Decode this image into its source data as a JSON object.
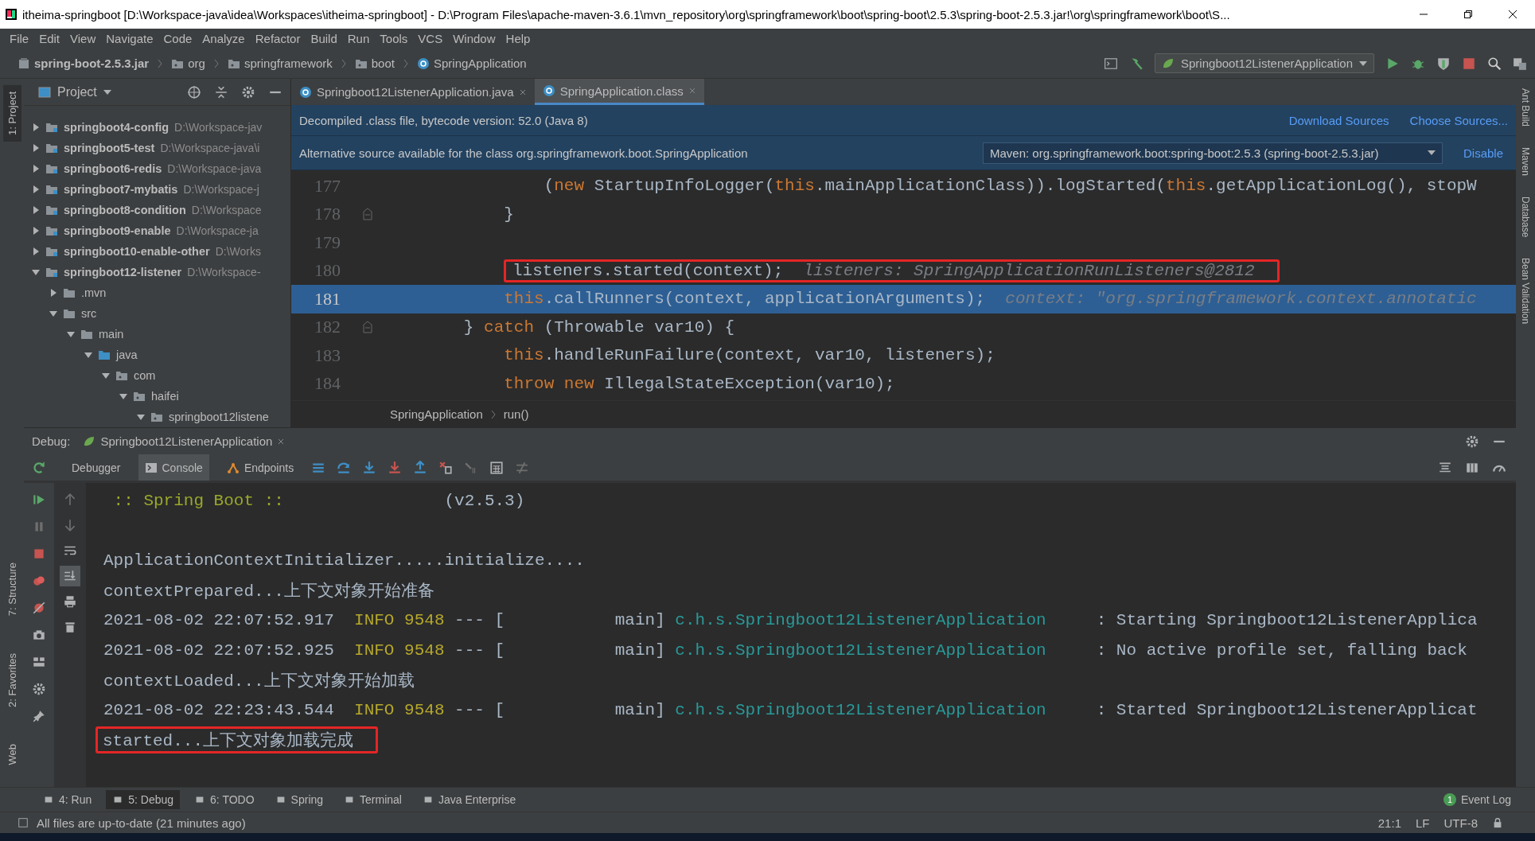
{
  "window": {
    "title": "itheima-springboot [D:\\Workspace-java\\idea\\Workspaces\\itheima-springboot] - D:\\Program Files\\apache-maven-3.6.1\\mvn_repository\\org\\springframework\\boot\\spring-boot\\2.5.3\\spring-boot-2.5.3.jar!\\org\\springframework\\boot\\S..."
  },
  "menu": [
    "File",
    "Edit",
    "View",
    "Navigate",
    "Code",
    "Analyze",
    "Refactor",
    "Build",
    "Run",
    "Tools",
    "VCS",
    "Window",
    "Help"
  ],
  "nav": {
    "crumbs": [
      {
        "text": "spring-boot-2.5.3.jar",
        "kind": "jar"
      },
      {
        "text": "org",
        "kind": "folder"
      },
      {
        "text": "springframework",
        "kind": "folder"
      },
      {
        "text": "boot",
        "kind": "folder"
      },
      {
        "text": "SpringApplication",
        "kind": "class"
      }
    ],
    "run_config": "Springboot12ListenerApplication"
  },
  "left_stripe": [
    {
      "label": "1: Project",
      "selected": true
    },
    {
      "label": "7: Structure",
      "selected": false
    },
    {
      "label": "2: Favorites",
      "selected": false
    },
    {
      "label": "Web",
      "selected": false
    }
  ],
  "right_stripe": [
    "Ant Build",
    "Maven",
    "Database",
    "Bean Validation"
  ],
  "project": {
    "title": "Project",
    "tree": [
      {
        "name": "springboot4-config",
        "path": "D:\\Workspace-jav",
        "kind": "module",
        "expanded": false
      },
      {
        "name": "springboot5-test",
        "path": "D:\\Workspace-java\\i",
        "kind": "module",
        "expanded": false
      },
      {
        "name": "springboot6-redis",
        "path": "D:\\Workspace-java",
        "kind": "module",
        "expanded": false
      },
      {
        "name": "springboot7-mybatis",
        "path": "D:\\Workspace-j",
        "kind": "module",
        "expanded": false
      },
      {
        "name": "springboot8-condition",
        "path": "D:\\Workspace",
        "kind": "module",
        "expanded": false
      },
      {
        "name": "springboot9-enable",
        "path": "D:\\Workspace-ja",
        "kind": "module",
        "expanded": false
      },
      {
        "name": "springboot10-enable-other",
        "path": "D:\\Works",
        "kind": "module",
        "expanded": false
      },
      {
        "name": "springboot12-listener",
        "path": "D:\\Workspace-",
        "kind": "module",
        "expanded": true,
        "children": [
          {
            "name": ".mvn",
            "kind": "folder",
            "expanded": false
          },
          {
            "name": "src",
            "kind": "folder",
            "expanded": true,
            "children": [
              {
                "name": "main",
                "kind": "folder",
                "expanded": true,
                "children": [
                  {
                    "name": "java",
                    "kind": "source",
                    "expanded": true,
                    "children": [
                      {
                        "name": "com",
                        "kind": "package",
                        "expanded": true,
                        "children": [
                          {
                            "name": "haifei",
                            "kind": "package",
                            "expanded": true,
                            "children": [
                              {
                                "name": "springboot12listene",
                                "kind": "package",
                                "expanded": true
                              }
                            ]
                          }
                        ]
                      }
                    ]
                  }
                ]
              }
            ]
          }
        ]
      }
    ]
  },
  "editor": {
    "tabs": [
      {
        "label": "Springboot12ListenerApplication.java",
        "selected": false
      },
      {
        "label": "SpringApplication.class",
        "selected": true
      }
    ],
    "notice": {
      "text": "Decompiled .class file, bytecode version: 52.0 (Java 8)",
      "links": [
        "Download Sources",
        "Choose Sources..."
      ]
    },
    "alternative": {
      "text": "Alternative source available for the class org.springframework.boot.SpringApplication",
      "source": "Maven: org.springframework.boot:spring-boot:2.5.3 (spring-boot-2.5.3.jar)",
      "link": "Disable"
    },
    "lines": [
      {
        "number": "177",
        "current": false,
        "boxed": false,
        "fold": false,
        "tokens": [
          {
            "kind": "plain",
            "text": "                ("
          },
          {
            "kind": "keyword",
            "text": "new"
          },
          {
            "kind": "plain",
            "text": " StartupInfoLogger("
          },
          {
            "kind": "keyword",
            "text": "this"
          },
          {
            "kind": "plain",
            "text": ".mainApplicationClass)).logStarted("
          },
          {
            "kind": "keyword",
            "text": "this"
          },
          {
            "kind": "plain",
            "text": ".getApplicationLog(), stopW"
          }
        ]
      },
      {
        "number": "178",
        "current": false,
        "boxed": false,
        "fold": true,
        "tokens": [
          {
            "kind": "plain",
            "text": "            }"
          }
        ]
      },
      {
        "number": "179",
        "current": false,
        "boxed": false,
        "fold": false
      },
      {
        "number": "180",
        "current": false,
        "boxed": true,
        "fold": false,
        "tokens": [
          {
            "kind": "plain",
            "text": "listeners.started(context);  "
          },
          {
            "kind": "hint",
            "text": "listeners: SpringApplicationRunListeners@2812"
          }
        ]
      },
      {
        "number": "181",
        "current": true,
        "boxed": false,
        "fold": false,
        "tokens": [
          {
            "kind": "keyword",
            "text": "            this"
          },
          {
            "kind": "plain",
            "text": ".callRunners(context, applicationArguments);  "
          },
          {
            "kind": "hint",
            "text": "context: \"org.springframework.context.annotatic"
          }
        ]
      },
      {
        "number": "182",
        "current": false,
        "boxed": false,
        "fold": true,
        "tokens": [
          {
            "kind": "plain",
            "text": "        } "
          },
          {
            "kind": "keyword",
            "text": "catch"
          },
          {
            "kind": "plain",
            "text": " (Throwable var10) {"
          }
        ]
      },
      {
        "number": "183",
        "current": false,
        "boxed": false,
        "fold": false,
        "tokens": [
          {
            "kind": "keyword",
            "text": "            this"
          },
          {
            "kind": "plain",
            "text": ".handleRunFailure(context, var10, listeners);"
          }
        ]
      },
      {
        "number": "184",
        "current": false,
        "boxed": false,
        "fold": false,
        "tokens": [
          {
            "kind": "keyword",
            "text": "            throw new"
          },
          {
            "kind": "plain",
            "text": " IllegalStateException(var10);"
          }
        ]
      }
    ],
    "breadcrumb": [
      "SpringApplication",
      "run()"
    ]
  },
  "debug": {
    "label": "Debug:",
    "session": "Springboot12ListenerApplication",
    "tabs": [
      {
        "label": "Debugger",
        "selected": false
      },
      {
        "label": "Console",
        "selected": true
      },
      {
        "label": "Endpoints",
        "selected": false
      }
    ],
    "console": [
      {
        "boxed": false,
        "tokens": [
          {
            "kind": "banner",
            "text": " :: Spring Boot ::"
          },
          {
            "kind": "plain",
            "text": "                (v2.5.3)"
          }
        ]
      },
      {
        "boxed": false
      },
      {
        "boxed": false,
        "tokens": [
          {
            "kind": "plain",
            "text": "ApplicationContextInitializer.....initialize...."
          }
        ]
      },
      {
        "boxed": false,
        "tokens": [
          {
            "kind": "plain",
            "text": "contextPrepared...上下文对象开始准备"
          }
        ]
      },
      {
        "boxed": false,
        "tokens": [
          {
            "kind": "plain",
            "text": "2021-08-02 22:07:52.917  "
          },
          {
            "kind": "level",
            "text": "INFO 9548"
          },
          {
            "kind": "plain",
            "text": " --- [           main] "
          },
          {
            "kind": "logger",
            "text": "c.h.s.Springboot12ListenerApplication"
          },
          {
            "kind": "plain",
            "text": "     : Starting Springboot12ListenerApplica"
          }
        ]
      },
      {
        "boxed": false,
        "tokens": [
          {
            "kind": "plain",
            "text": "2021-08-02 22:07:52.925  "
          },
          {
            "kind": "level",
            "text": "INFO 9548"
          },
          {
            "kind": "plain",
            "text": " --- [           main] "
          },
          {
            "kind": "logger",
            "text": "c.h.s.Springboot12ListenerApplication"
          },
          {
            "kind": "plain",
            "text": "     : No active profile set, falling back"
          }
        ]
      },
      {
        "boxed": false,
        "tokens": [
          {
            "kind": "plain",
            "text": "contextLoaded...上下文对象开始加载"
          }
        ]
      },
      {
        "boxed": false,
        "tokens": [
          {
            "kind": "plain",
            "text": "2021-08-02 22:23:43.544  "
          },
          {
            "kind": "level",
            "text": "INFO 9548"
          },
          {
            "kind": "plain",
            "text": " --- [           main] "
          },
          {
            "kind": "logger",
            "text": "c.h.s.Springboot12ListenerApplication"
          },
          {
            "kind": "plain",
            "text": "     : Started Springboot12ListenerApplicat"
          }
        ]
      },
      {
        "boxed": true,
        "tokens": [
          {
            "kind": "plain",
            "text": "started...上下文对象加载完成"
          }
        ]
      }
    ]
  },
  "tool_tabs": [
    {
      "label": "4: Run",
      "selected": false
    },
    {
      "label": "5: Debug",
      "selected": true
    },
    {
      "label": "6: TODO",
      "selected": false
    },
    {
      "label": "Spring",
      "selected": false
    },
    {
      "label": "Terminal",
      "selected": false
    },
    {
      "label": "Java Enterprise",
      "selected": false
    }
  ],
  "event_log": {
    "label": "Event Log",
    "count": "1"
  },
  "status": {
    "message": "All files are up-to-date (21 minutes ago)",
    "position": "21:1",
    "line_separator": "LF",
    "encoding": "UTF-8"
  }
}
